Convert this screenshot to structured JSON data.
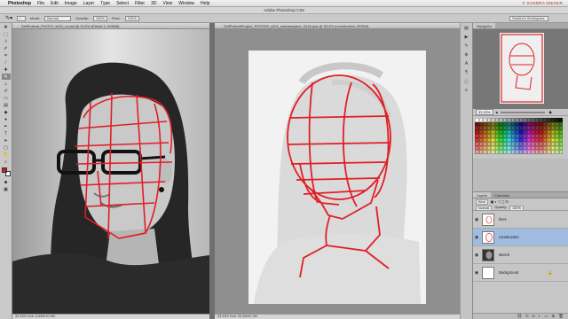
{
  "menu": {
    "apple": "",
    "app": "Photoshop",
    "items": [
      "File",
      "Edit",
      "Image",
      "Layer",
      "Type",
      "Select",
      "Filter",
      "3D",
      "View",
      "Window",
      "Help"
    ]
  },
  "watermark": "© SANDRA DIEKER",
  "window_title": "Adobe Photoshop CS6",
  "options": {
    "mode_label": "Mode:",
    "mode_value": "Normal",
    "opacity_label": "Opacity:",
    "opacity_value": "100%",
    "flow_label": "Flow:",
    "flow_value": "100%",
    "workspace": "Sandra's Workspace"
  },
  "doc_left": {
    "tab": "SelfPortrait_PHOTO_s001_cr.psd @ 33,3% (Ebene 1, RGB/8)",
    "status": "33,33%    Dok: 5,49M/10,9M"
  },
  "doc_right": {
    "tab": "SelfPortraitProject_POSTER_s001_sadrawspace_2016.psd @ 33,3% (construction, RGB/8)",
    "status": "33,33%    Dok: 25,2M/61,0M"
  },
  "panel": {
    "top_tabs": [
      "Navigator"
    ],
    "zoom_value": "33,33%",
    "layer_tabs": [
      "Layers",
      "Channels"
    ],
    "kind_label": "Kind",
    "blend_value": "Normal",
    "opacity_label": "Opacity:",
    "opacity_value": "100%",
    "lock_label": "Lock:",
    "fill_label": "Fill:",
    "fill_value": "100%",
    "layers": [
      {
        "name": "lines",
        "selected": false
      },
      {
        "name": "construction",
        "selected": true
      },
      {
        "name": "sketch",
        "selected": false
      },
      {
        "name": "Background",
        "selected": false
      }
    ]
  },
  "tools": [
    "move",
    "marquee",
    "lasso",
    "quick-select",
    "crop",
    "eyedropper",
    "healing",
    "brush",
    "stamp",
    "history",
    "eraser",
    "gradient",
    "blur",
    "dodge",
    "pen",
    "type",
    "path-select",
    "shape",
    "hand",
    "zoom"
  ],
  "colors": {
    "foreground": "#d01c1c",
    "accent_layer": "#9fbbdf"
  }
}
